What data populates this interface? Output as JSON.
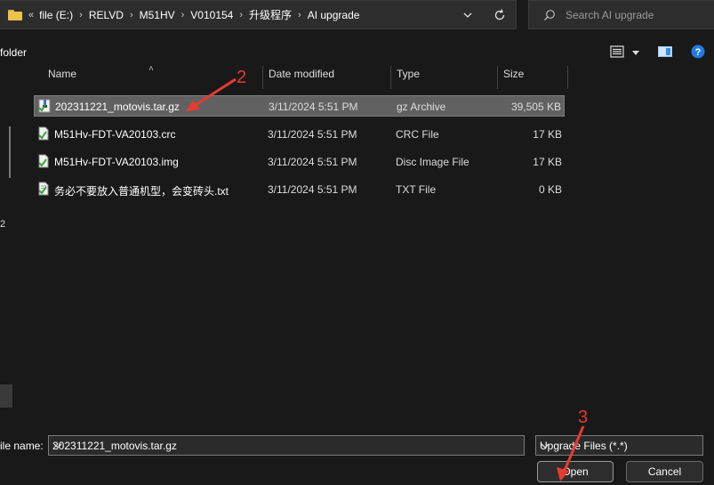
{
  "breadcrumb": [
    "file (E:)",
    "RELVD",
    "M51HV",
    "V010154",
    "升级程序",
    "AI upgrade"
  ],
  "breadcrumb_prefix": "«",
  "search": {
    "placeholder": "Search AI upgrade"
  },
  "toolbar": {
    "new_folder_label": "folder"
  },
  "nav": {
    "partial_text": "2"
  },
  "columns": {
    "name": "Name",
    "date": "Date modified",
    "type": "Type",
    "size": "Size"
  },
  "files": [
    {
      "name": "202311221_motovis.tar.gz",
      "date": "3/11/2024 5:51 PM",
      "type": "gz Archive",
      "size": "39,505 KB",
      "icon": "archive-file-icon",
      "selected": true
    },
    {
      "name": "M51Hv-FDT-VA20103.crc",
      "date": "3/11/2024 5:51 PM",
      "type": "CRC File",
      "size": "17 KB",
      "icon": "file-icon",
      "selected": false
    },
    {
      "name": "M51Hv-FDT-VA20103.img",
      "date": "3/11/2024 5:51 PM",
      "type": "Disc Image File",
      "size": "17 KB",
      "icon": "file-icon",
      "selected": false
    },
    {
      "name": "务必不要放入普通机型，会变砖头.txt",
      "date": "3/11/2024 5:51 PM",
      "type": "TXT File",
      "size": "0 KB",
      "icon": "text-file-icon",
      "selected": false
    }
  ],
  "filename": {
    "label": "ile name:",
    "value": "202311221_motovis.tar.gz"
  },
  "filter": {
    "value": "Upgrade Files (*.*)"
  },
  "buttons": {
    "open": "Open",
    "cancel": "Cancel"
  },
  "annotations": {
    "step2": "2",
    "step3": "3"
  },
  "colors": {
    "accent": "#0a84ff",
    "annotation": "#e83a2f",
    "selection": "#616161"
  }
}
